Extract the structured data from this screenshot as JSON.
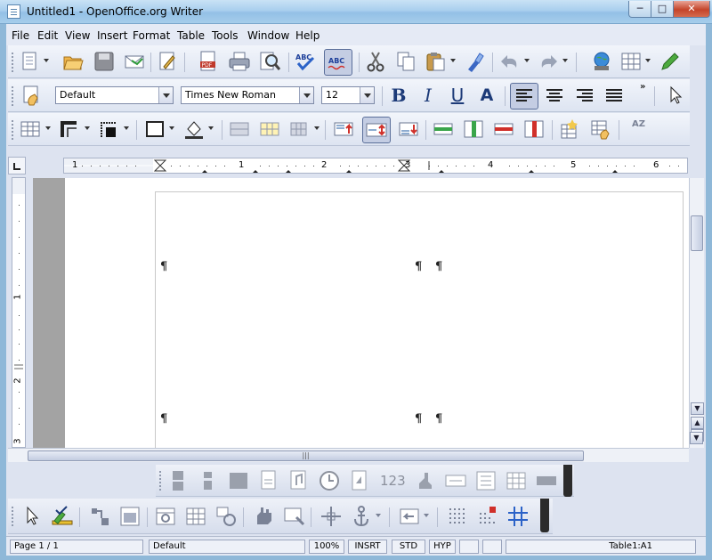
{
  "window": {
    "title": "Untitled1 - OpenOffice.org Writer",
    "close_glyph": "✕",
    "max_glyph": "□",
    "min_glyph": "─"
  },
  "menu": [
    "File",
    "Edit",
    "View",
    "Insert",
    "Format",
    "Table",
    "Tools",
    "Window",
    "Help"
  ],
  "formatting": {
    "paragraph_style": "Default",
    "font_name": "Times New Roman",
    "font_size": "12",
    "bold": "B",
    "italic": "I",
    "underline": "U",
    "font_color": "A"
  },
  "ruler": {
    "h_marks": [
      "1",
      "1",
      "2",
      "3",
      "4",
      "5",
      "6"
    ],
    "v_marks": [
      "1",
      "2",
      "3"
    ]
  },
  "drawing_text": {
    "number_label": "123"
  },
  "spelling_icon_text": "ABC",
  "sort_icon_text": "AZ",
  "statusbar": {
    "page": "Page 1 / 1",
    "style": "Default",
    "zoom": "100%",
    "insert_mode": "INSRT",
    "selection_mode": "STD",
    "hyperlink_mode": "HYP",
    "cell": "Table1:A1"
  },
  "colors": {
    "accent": "#4a6fb5",
    "titlebar": "#a9cfee",
    "frame": "#dde3f0",
    "pdf_red": "#c0392b"
  },
  "icons": [
    "new-icon",
    "open-icon",
    "save-icon",
    "email-icon",
    "edit-file-icon",
    "pdf-icon",
    "print-icon",
    "preview-icon",
    "spellcheck-icon",
    "autospell-icon",
    "cut-icon",
    "copy-icon",
    "paste-icon",
    "format-paintbrush-icon",
    "undo-icon",
    "redo-icon",
    "navigator-icon",
    "table-icon",
    "draw-icon",
    "select-icon"
  ]
}
